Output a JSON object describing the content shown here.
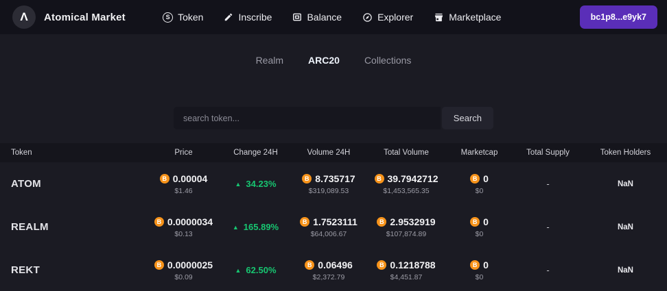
{
  "header": {
    "brand": "Atomical Market",
    "logo_glyph": "Λ",
    "nav": [
      {
        "label": "Token",
        "icon": "token-dollar-icon"
      },
      {
        "label": "Inscribe",
        "icon": "pencil-icon"
      },
      {
        "label": "Balance",
        "icon": "wallet-card-icon"
      },
      {
        "label": "Explorer",
        "icon": "compass-icon"
      },
      {
        "label": "Marketplace",
        "icon": "store-icon"
      }
    ],
    "wallet_address": "bc1p8...e9yk7"
  },
  "tabs": [
    {
      "label": "Realm",
      "active": false
    },
    {
      "label": "ARC20",
      "active": true
    },
    {
      "label": "Collections",
      "active": false
    }
  ],
  "search": {
    "placeholder": "search token...",
    "button_label": "Search"
  },
  "colors": {
    "accent_purple": "#5a2eb8",
    "bitcoin_orange": "#f7931a",
    "up_green": "#17c671",
    "navbar_bg": "#12121a",
    "page_bg": "#1b1b23"
  },
  "table": {
    "columns": [
      "Token",
      "Price",
      "Change 24H",
      "Volume 24H",
      "Total Volume",
      "Marketcap",
      "Total Supply",
      "Token Holders"
    ],
    "rows": [
      {
        "token": "ATOM",
        "price_btc": "0.00004",
        "price_usd": "$1.46",
        "change": "34.23%",
        "change_dir": "up",
        "vol24_btc": "8.735717",
        "vol24_usd": "$319,089.53",
        "total_vol_btc": "39.7942712",
        "total_vol_usd": "$1,453,565.35",
        "mcap_btc": "0",
        "mcap_usd": "$0",
        "supply": "-",
        "holders": "NaN"
      },
      {
        "token": "REALM",
        "price_btc": "0.0000034",
        "price_usd": "$0.13",
        "change": "165.89%",
        "change_dir": "up",
        "vol24_btc": "1.7523111",
        "vol24_usd": "$64,006.67",
        "total_vol_btc": "2.9532919",
        "total_vol_usd": "$107,874.89",
        "mcap_btc": "0",
        "mcap_usd": "$0",
        "supply": "-",
        "holders": "NaN"
      },
      {
        "token": "REKT",
        "price_btc": "0.0000025",
        "price_usd": "$0.09",
        "change": "62.50%",
        "change_dir": "up",
        "vol24_btc": "0.06496",
        "vol24_usd": "$2,372.79",
        "total_vol_btc": "0.1218788",
        "total_vol_usd": "$4,451.87",
        "mcap_btc": "0",
        "mcap_usd": "$0",
        "supply": "-",
        "holders": "NaN"
      }
    ]
  }
}
